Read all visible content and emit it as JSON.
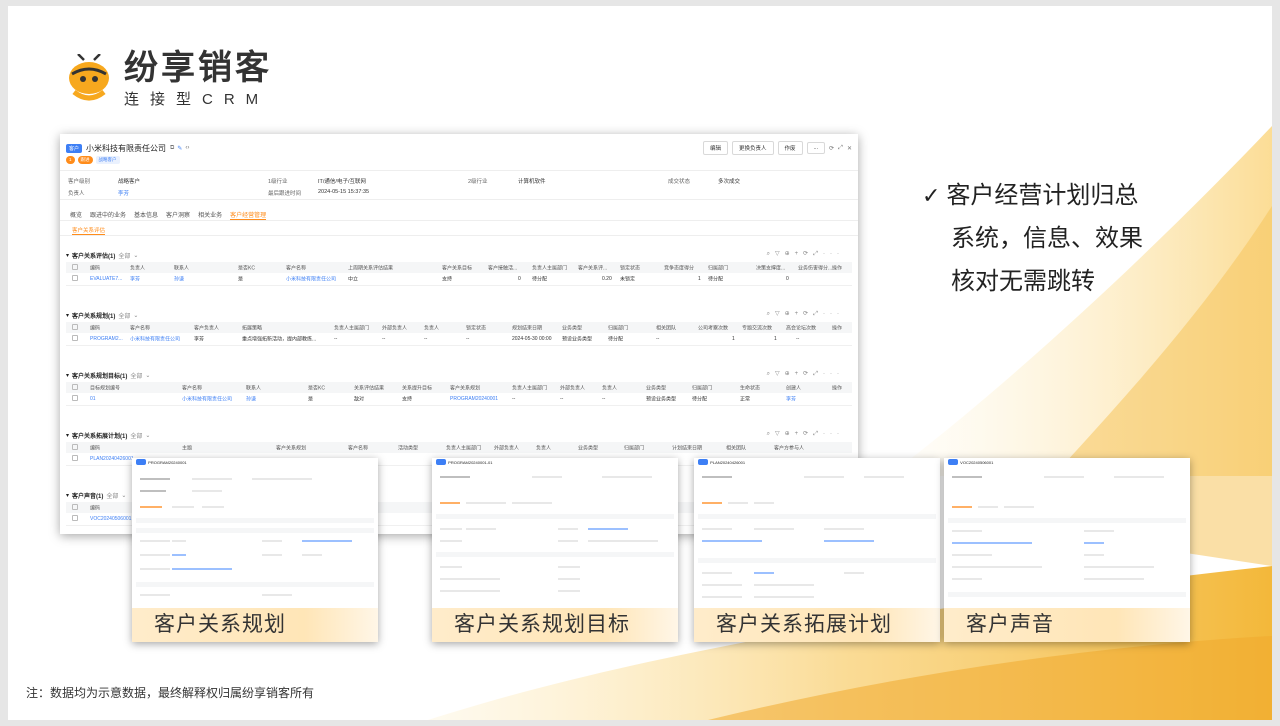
{
  "logo": {
    "title": "纷享销客",
    "subtitle": "连接型CRM"
  },
  "window": {
    "type_tag": "客户",
    "title": "小米科技有限责任公司",
    "badge_num": "1",
    "tag_orange": "跟进",
    "tag_strategic": "战略客户",
    "buttons": [
      "编辑",
      "更换负责人",
      "作废",
      "..."
    ],
    "info": {
      "level_label": "客户级别",
      "level_value": "战略客户",
      "owner_label": "负责人",
      "owner_value": "李芳",
      "ind1_label": "1级行业",
      "ind1_value": "IT/通信/电子/互联网",
      "last_follow_label": "最后跟进时间",
      "last_follow_value": "2024-05-15 15:37:35",
      "ind2_label": "2级行业",
      "ind2_value": "计算机软件",
      "deal_label": "成交状态",
      "deal_value": "多次成交"
    },
    "tabs": [
      "概览",
      "跟进中的业务",
      "基本信息",
      "客户洞察",
      "相关业务",
      "客户经营管理"
    ],
    "subtab": "客户关系评估",
    "sections": [
      {
        "title": "客户关系评估(1)",
        "filter": "全部",
        "headers": [
          "编码",
          "负责人",
          "联系人",
          "是否KC",
          "客户名称",
          "上周期关系评估结果",
          "客户关系目标",
          "客户接触活...",
          "负责人主属部门",
          "客户关系评...",
          "锁定状态",
          "竞争态度得分",
          "归属部门",
          "决策支撑度...",
          "业务伤害得分...",
          "操作"
        ],
        "row": [
          "EVALUATE7...",
          "李芳",
          "孙谦",
          "是",
          "小米科技有限责任公司",
          "中立",
          "支持",
          "0",
          "待分配",
          "0.20",
          "未锁定",
          "1",
          "待分配",
          "0"
        ]
      },
      {
        "title": "客户关系规划(1)",
        "filter": "全部",
        "headers": [
          "编码",
          "客户名称",
          "客户负责人",
          "拓展策略",
          "负责人主属部门",
          "外部负责人",
          "负责人",
          "锁定状态",
          "规划结束日期",
          "业务类型",
          "归属部门",
          "相关团队",
          "公司考察次数",
          "专题交流次数",
          "高会论坛次数",
          "操作"
        ],
        "row": [
          "PROGRAM2...",
          "小米科技有限责任公司",
          "李芳",
          "重点增强拓新活动，提内部教练...",
          "--",
          "--",
          "--",
          "--",
          "2024-05-30 00:00",
          "预设业务类型",
          "待分配",
          "--",
          "1",
          "1",
          "--"
        ]
      },
      {
        "title": "客户关系规划目标(1)",
        "filter": "全部",
        "headers": [
          "目标规划编号",
          "客户名称",
          "联系人",
          "是否KC",
          "关系评估结果",
          "关系提升目标",
          "客户关系规划",
          "负责人主属部门",
          "外部负责人",
          "负责人",
          "业务类型",
          "归属部门",
          "生命状态",
          "创建人",
          "操作"
        ],
        "row": [
          "01",
          "小米科技有限责任公司",
          "孙谦",
          "是",
          "敌对",
          "支持",
          "PROGRAM20240001",
          "--",
          "--",
          "--",
          "预设业务类型",
          "待分配",
          "正常",
          "李芳"
        ]
      },
      {
        "title": "客户关系拓展计划(1)",
        "filter": "全部",
        "headers": [
          "编码",
          "主题",
          "客户关系规划",
          "客户名称",
          "活动类型",
          "负责人主属部门",
          "外部负责人",
          "负责人",
          "业务类型",
          "归属部门",
          "计划结束日期",
          "相关团队",
          "客户方参与人"
        ],
        "row": [
          "PLAN20240426001"
        ]
      },
      {
        "title": "客户声音(1)",
        "filter": "全部",
        "headers": [
          "编码"
        ],
        "row": [
          "VOC20240506001"
        ]
      }
    ]
  },
  "bullet": {
    "check": "✓",
    "lines": [
      "客户经营计划归总",
      "系统，信息、效果",
      "核对无需跳转"
    ]
  },
  "thumbnails": [
    {
      "code": "PROGRAM20240001",
      "caption": "客户关系规划"
    },
    {
      "code": "PROGRAM20240001-01",
      "caption": "客户关系规划目标"
    },
    {
      "code": "PLAN20240426001",
      "caption": "客户关系拓展计划"
    },
    {
      "code": "VOC20240506001",
      "caption": "客户声音"
    }
  ],
  "note": "注：数据均为示意数据，最终解释权归属纷享销客所有",
  "colors": {
    "accent": "#ff8c1a",
    "link": "#3d7ff5",
    "wave": "#f7c65a"
  }
}
